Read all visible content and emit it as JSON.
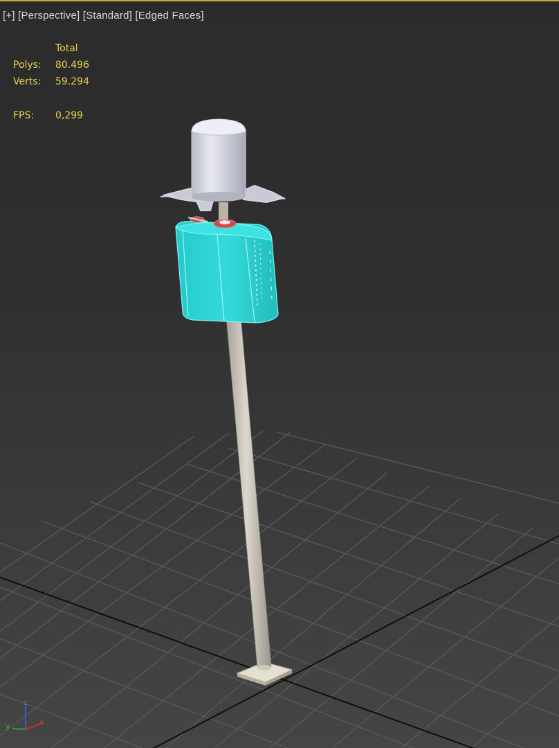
{
  "viewport": {
    "labels": {
      "plus": "[+]",
      "view": "[Perspective]",
      "shading": "[Standard]",
      "edges": "[Edged Faces]"
    },
    "stats": {
      "header": "Total",
      "polys_label": "Polys:",
      "polys_value": "80.496",
      "verts_label": "Verts:",
      "verts_value": "59.294",
      "fps_label": "FPS:",
      "fps_value": "0,299"
    },
    "axis_tripod": {
      "x": "x",
      "y": "y",
      "z": "z"
    }
  },
  "colors": {
    "active_border": "#c8a83a",
    "stats_text": "#e8d14a",
    "selected_object": "#2ad4d4",
    "grid_line": "#5a5a5a",
    "grid_axis": "#111111"
  }
}
